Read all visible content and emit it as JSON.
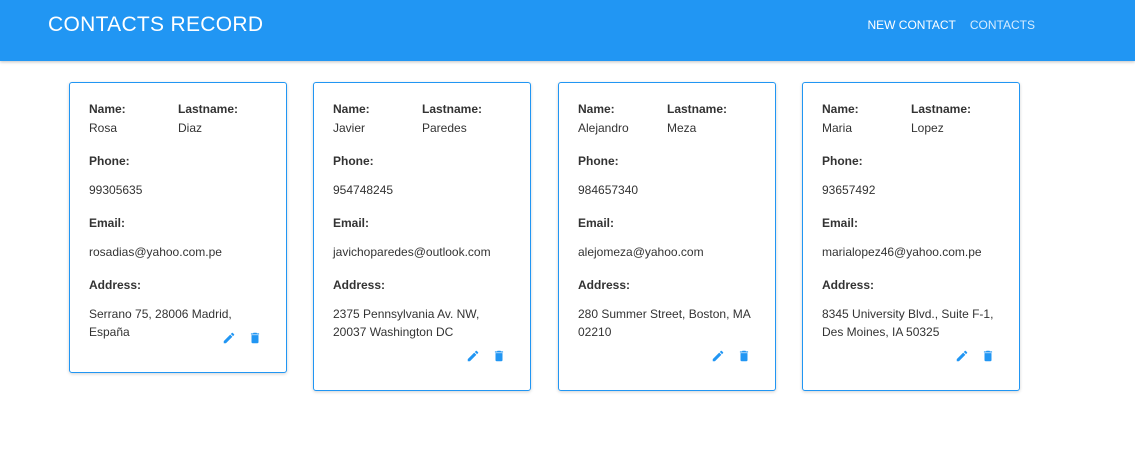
{
  "header": {
    "title": "CONTACTS RECORD",
    "nav": [
      {
        "label": "NEW CONTACT",
        "active": true
      },
      {
        "label": "CONTACTS",
        "active": false
      }
    ]
  },
  "labels": {
    "name": "Name:",
    "lastname": "Lastname:",
    "phone": "Phone:",
    "email": "Email:",
    "address": "Address:"
  },
  "contacts": [
    {
      "name": "Rosa",
      "lastname": "Diaz",
      "phone": "99305635",
      "email": "rosadias@yahoo.com.pe",
      "address": "Serrano 75, 28006 Madrid, España"
    },
    {
      "name": "Javier",
      "lastname": "Paredes",
      "phone": "954748245",
      "email": "javichoparedes@outlook.com",
      "address": "2375 Pennsylvania Av. NW, 20037 Washington DC"
    },
    {
      "name": "Alejandro",
      "lastname": "Meza",
      "phone": "984657340",
      "email": "alejomeza@yahoo.com",
      "address": "280 Summer Street, Boston, MA 02210"
    },
    {
      "name": "Maria",
      "lastname": "Lopez",
      "phone": "93657492",
      "email": "marialopez46@yahoo.com.pe",
      "address": "8345 University Blvd., Suite F-1, Des Moines, IA 50325"
    }
  ],
  "icons": {
    "edit": "pencil-icon",
    "delete": "trash-icon"
  },
  "colors": {
    "primary": "#2196f3",
    "text": "#333333"
  }
}
